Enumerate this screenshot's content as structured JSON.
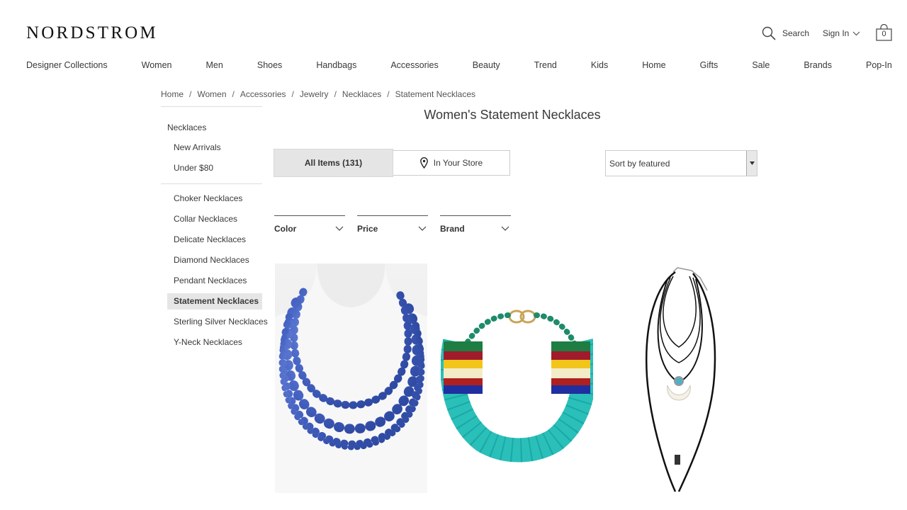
{
  "header": {
    "logo": "NORDSTROM",
    "search_label": "Search",
    "signin_label": "Sign In",
    "bag_count": "0"
  },
  "nav": [
    "Designer Collections",
    "Women",
    "Men",
    "Shoes",
    "Handbags",
    "Accessories",
    "Beauty",
    "Trend",
    "Kids",
    "Home",
    "Gifts",
    "Sale",
    "Brands",
    "Pop-In"
  ],
  "breadcrumb": [
    "Home",
    "Women",
    "Accessories",
    "Jewelry",
    "Necklaces",
    "Statement Necklaces"
  ],
  "page_title": "Women's Statement Necklaces",
  "sidebar": {
    "heading": "Necklaces",
    "group1": [
      "New Arrivals",
      "Under $80"
    ],
    "group2": [
      "Choker Necklaces",
      "Collar Necklaces",
      "Delicate Necklaces",
      "Diamond Necklaces",
      "Pendant Necklaces",
      "Statement Necklaces",
      "Sterling Silver Necklaces",
      "Y-Neck Necklaces"
    ],
    "active": "Statement Necklaces"
  },
  "toggle": {
    "all_items": "All Items (131)",
    "in_store": "In Your Store"
  },
  "sort": {
    "selected": "Sort by featured"
  },
  "filters": [
    "Color",
    "Price",
    "Brand"
  ],
  "products": [
    {
      "image": "blue-beaded-multistrand-necklace"
    },
    {
      "image": "turquoise-multicolor-bead-collar-necklace"
    },
    {
      "image": "black-cord-layered-horn-pendant-necklace"
    }
  ]
}
